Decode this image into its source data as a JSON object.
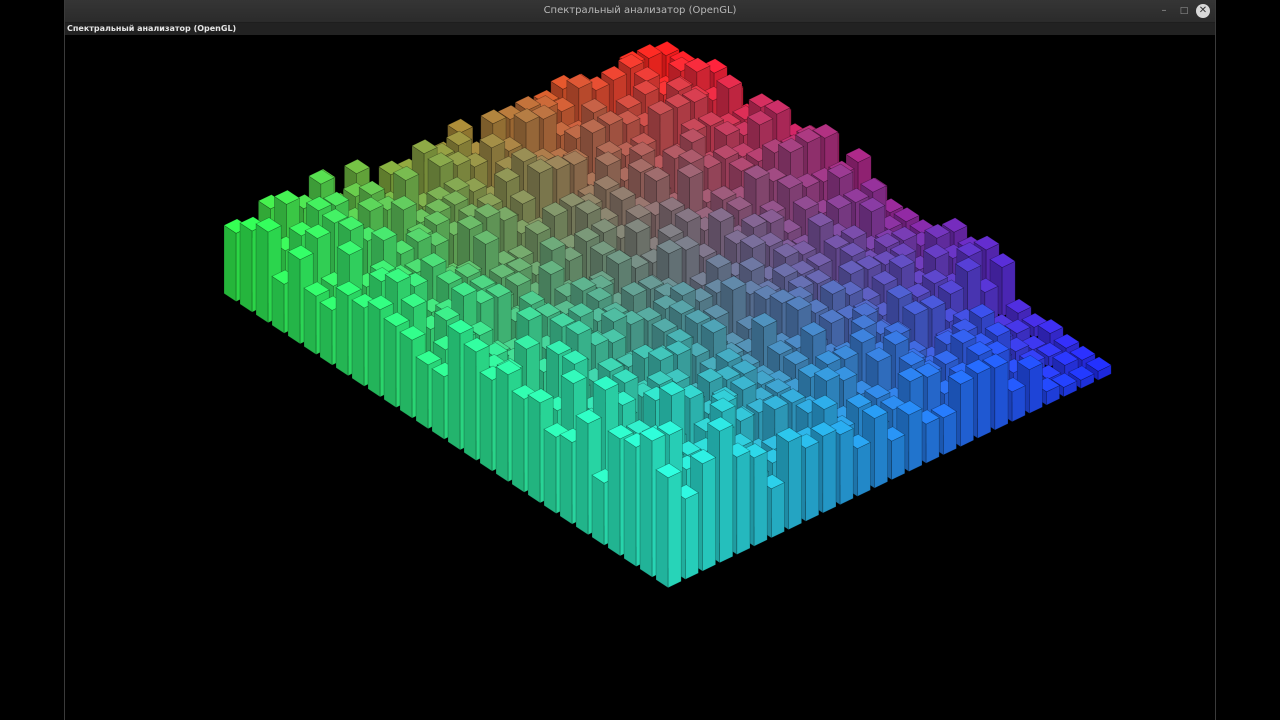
{
  "window": {
    "title": "Спектральный анализатор (OpenGL)",
    "caption": "Спектральный анализатор (OpenGL)",
    "controls": {
      "minimize": "–",
      "maximize": "□",
      "close": "✕"
    }
  },
  "visualization": {
    "type": "3d-bar-spectrum",
    "grid_cols": 28,
    "grid_rows": 26,
    "color_corners": {
      "near": "#2ae6c8",
      "left": "#2fe84a",
      "far": "#ff1e1e",
      "right": "#1f2cf0"
    }
  }
}
